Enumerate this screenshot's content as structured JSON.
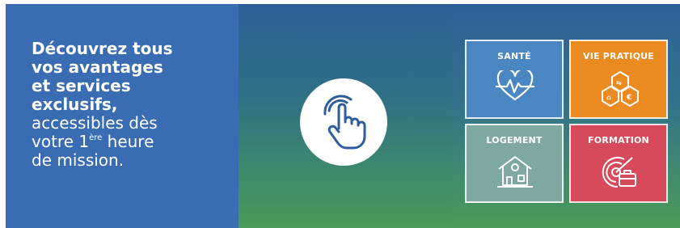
{
  "promo": {
    "headline_lines": [
      "Découvrez tous",
      "vos avantages",
      "et services",
      "exclusifs,"
    ],
    "sub_line1": "accessibles dès",
    "sub_line2_pre": "votre 1",
    "sub_line2_sup": "ère",
    "sub_line2_post": " heure",
    "sub_line3": "de mission."
  },
  "cta": {
    "icon": "tap-hand-icon"
  },
  "categories": [
    {
      "label": "SANTÉ",
      "icon": "heartbeat-icon",
      "color": "#4a86c2"
    },
    {
      "label": "VIE PRATIQUE",
      "icon": "hexagon-services-icon",
      "color": "#ec8a22"
    },
    {
      "label": "LOGEMENT",
      "icon": "house-icon",
      "color": "#7fa8a0"
    },
    {
      "label": "FORMATION",
      "icon": "target-briefcase-icon",
      "color": "#d64a5c"
    }
  ]
}
